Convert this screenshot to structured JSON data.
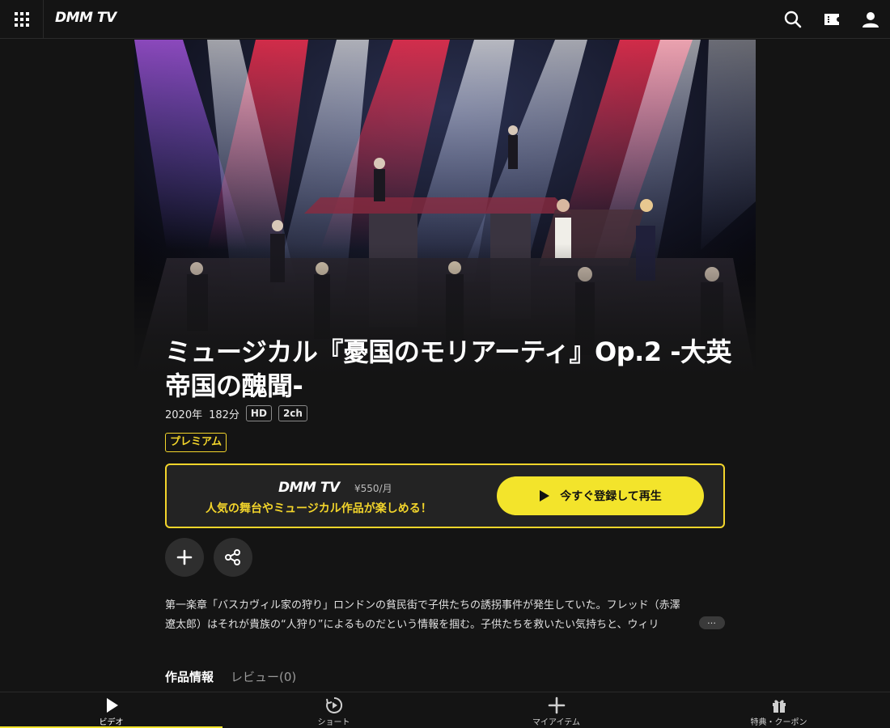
{
  "header": {
    "logo": "DMM TV",
    "icons": [
      "grid-menu-icon",
      "search-icon",
      "ticket-icon",
      "user-icon"
    ]
  },
  "content": {
    "title": "ミュージカル『憂国のモリアーティ』Op.2 -大英帝国の醜聞-",
    "year": "2020年",
    "duration": "182分",
    "tags": [
      "HD",
      "2ch"
    ],
    "badge": "プレミアム"
  },
  "promo": {
    "logo": "DMM TV",
    "price": "¥550/月",
    "tagline": "人気の舞台やミュージカル作品が楽しめる！",
    "cta_label": "今すぐ登録して再生"
  },
  "actions": {
    "add_icon": "plus-icon",
    "share_icon": "share-icon"
  },
  "description": {
    "line1": "第一楽章「バスカヴィル家の狩り」ロンドンの貧民街で子供たちの誘拐事件が発生していた。フレッド（赤澤",
    "line2": "遼太郎）はそれが貴族の“人狩り”によるものだという情報を掴む。子供たちを救いたい気持ちと、ウィリ",
    "more_label": "…"
  },
  "subtabs": {
    "info": "作品情報",
    "reviews": "レビュー(0)"
  },
  "bottom_nav": [
    {
      "label": "ビデオ",
      "icon": "play-icon",
      "active": true
    },
    {
      "label": "ショート",
      "icon": "short-play-icon",
      "active": false
    },
    {
      "label": "マイアイテム",
      "icon": "plus-icon",
      "active": false
    },
    {
      "label": "特典・クーポン",
      "icon": "gift-icon",
      "active": false
    }
  ],
  "colors": {
    "accent": "#f3e42b",
    "background": "#141414"
  }
}
